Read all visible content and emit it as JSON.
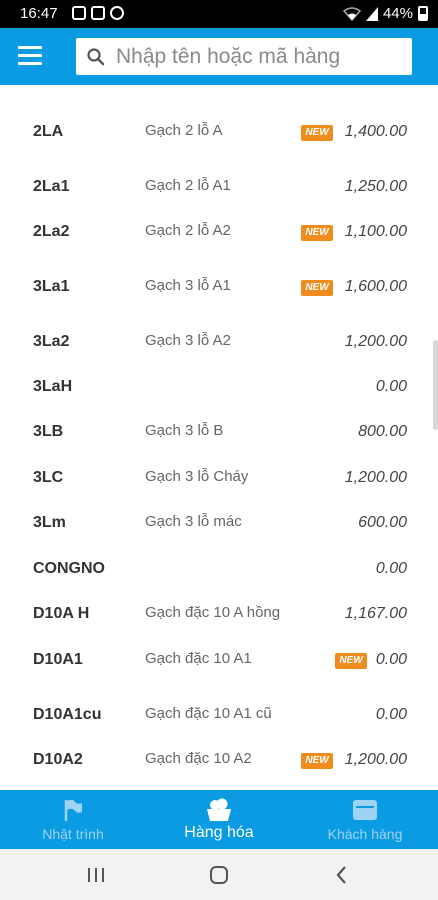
{
  "status_bar": {
    "time": "16:47",
    "battery": "44%"
  },
  "search": {
    "placeholder": "Nhập tên hoặc mã hàng"
  },
  "badge_label": "NEW",
  "colors": {
    "primary": "#0a9be3",
    "badge": "#f08c1e"
  },
  "products": [
    {
      "code": "2LA",
      "name": "Gạch 2 lỗ A",
      "price": "1,400.00",
      "is_new": true
    },
    {
      "code": "2La1",
      "name": "Gạch 2 lỗ A1",
      "price": "1,250.00",
      "is_new": false
    },
    {
      "code": "2La2",
      "name": "Gạch 2 lỗ A2",
      "price": "1,100.00",
      "is_new": true
    },
    {
      "code": "3La1",
      "name": "Gạch 3 lỗ A1",
      "price": "1,600.00",
      "is_new": true
    },
    {
      "code": "3La2",
      "name": "Gạch 3 lỗ A2",
      "price": "1,200.00",
      "is_new": false
    },
    {
      "code": "3LaH",
      "name": "",
      "price": "0.00",
      "is_new": false
    },
    {
      "code": "3LB",
      "name": "Gạch 3 lỗ B",
      "price": "800.00",
      "is_new": false
    },
    {
      "code": "3LC",
      "name": "Gạch 3 lỗ Cháy",
      "price": "1,200.00",
      "is_new": false
    },
    {
      "code": "3Lm",
      "name": "Gạch 3 lỗ mác",
      "price": "600.00",
      "is_new": false
    },
    {
      "code": "CONGNO",
      "name": "",
      "price": "0.00",
      "is_new": false
    },
    {
      "code": "D10A H",
      "name": "Gạch đặc 10 A hồng",
      "price": "1,167.00",
      "is_new": false
    },
    {
      "code": "D10A1",
      "name": "Gạch đặc 10 A1",
      "price": "0.00",
      "is_new": true
    },
    {
      "code": "D10A1cu",
      "name": "Gạch đặc 10 A1  cũ",
      "price": "0.00",
      "is_new": false
    },
    {
      "code": "D10A2",
      "name": "Gạch đặc 10 A2",
      "price": "1,200.00",
      "is_new": true
    }
  ],
  "bottom_nav": [
    {
      "label": "Nhật trình",
      "icon": "flag-icon",
      "active": false
    },
    {
      "label": "Hàng hóa",
      "icon": "basket-icon",
      "active": true
    },
    {
      "label": "Khách hàng",
      "icon": "contact-card-icon",
      "active": false
    }
  ],
  "system_nav": {
    "recent": "recent-apps-icon",
    "home": "home-icon",
    "back": "back-icon"
  }
}
